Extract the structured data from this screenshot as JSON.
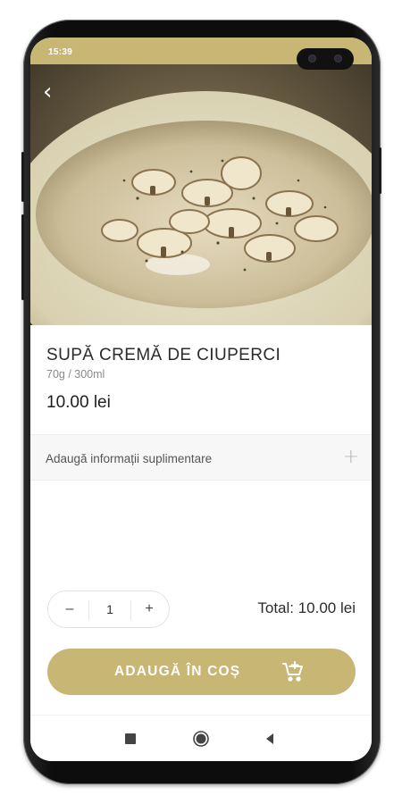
{
  "status_bar": {
    "time": "15:39"
  },
  "product": {
    "title": "SUPĂ CREMĂ DE CIUPERCI",
    "weight": "70g / 300ml",
    "price": "10.00 lei",
    "image_icon": "mushroom-soup-photo"
  },
  "extra_info": {
    "label": "Adaugă informații suplimentare",
    "toggle_icon": "plus-icon"
  },
  "quantity": {
    "decrement": "–",
    "value": "1",
    "increment": "+"
  },
  "total": {
    "label": "Total: 10.00 lei"
  },
  "add_to_cart": {
    "label": "ADAUGĂ ÎN COȘ",
    "icon": "cart-add-icon"
  },
  "navigation": {
    "back_icon": "back-arrow-icon",
    "buttons": [
      "recent-apps-icon",
      "home-icon",
      "back-triangle-icon"
    ]
  },
  "colors": {
    "accent": "#c8b675",
    "text": "#2b2b2b",
    "muted": "#8a8a8a"
  }
}
